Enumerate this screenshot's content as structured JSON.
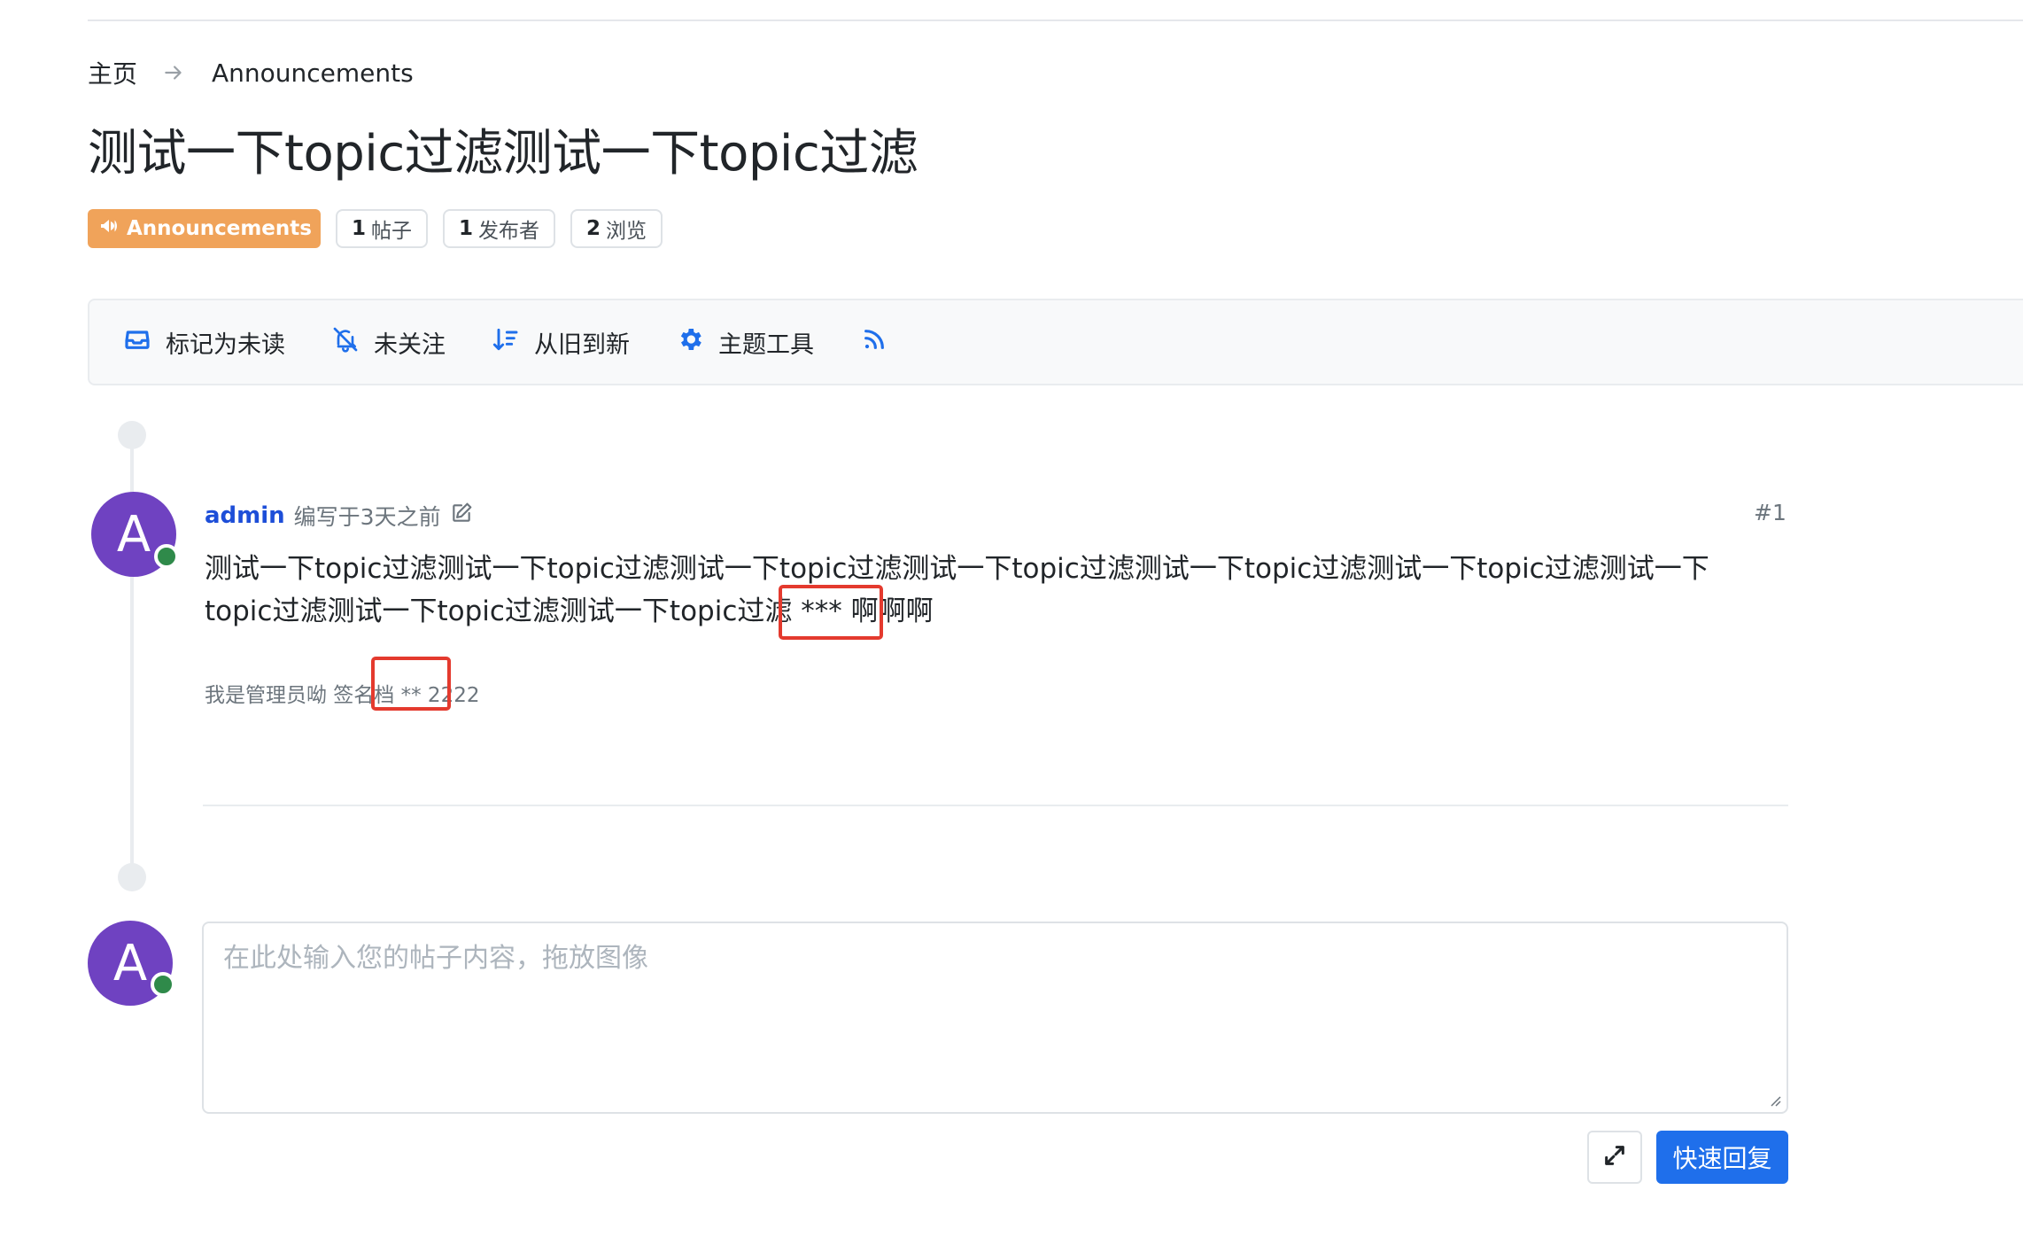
{
  "breadcrumb": {
    "home": "主页",
    "current": "Announcements"
  },
  "topic": {
    "title": "测试一下topic过滤测试一下topic过滤"
  },
  "stats": {
    "category": "Announcements",
    "posts_count": "1",
    "posts_label": "帖子",
    "posters_count": "1",
    "posters_label": "发布者",
    "views_count": "2",
    "views_label": "浏览"
  },
  "toolbar": {
    "mark_unread": "标记为未读",
    "not_watching": "未关注",
    "sort": "从旧到新",
    "topic_tools": "主题工具"
  },
  "post": {
    "avatar_letter": "A",
    "author": "admin",
    "meta": "编写于3天之前",
    "index": "#1",
    "body_line1": "测试一下topic过滤测试一下topic过滤测试一下topic过滤测试一下topic过滤测试一下topic过滤测试一下topic过滤测试一下",
    "body_line2": "topic过滤测试一下topic过滤测试一下topic过滤 *** 啊啊啊",
    "signature": "我是管理员呦 签名档 ** 2222"
  },
  "composer": {
    "avatar_letter": "A",
    "placeholder": "在此处输入您的帖子内容，拖放图像",
    "reply_label": "快速回复"
  },
  "colors": {
    "category": "#f0a35a",
    "avatar": "#6f42c1",
    "online": "#2f8a4a",
    "link": "#1d4ed8",
    "primary": "#1f6feb",
    "highlight_box": "#e43a2e"
  },
  "icons": {
    "breadcrumb_separator": "arrow-right-icon",
    "category": "bullhorn-icon",
    "mark_unread": "inbox-icon",
    "not_watching": "bell-slash-icon",
    "sort": "sort-amount-down-icon",
    "topic_tools": "gear-icon",
    "rss": "rss-icon",
    "edit": "edit-icon",
    "expand": "expand-icon"
  }
}
